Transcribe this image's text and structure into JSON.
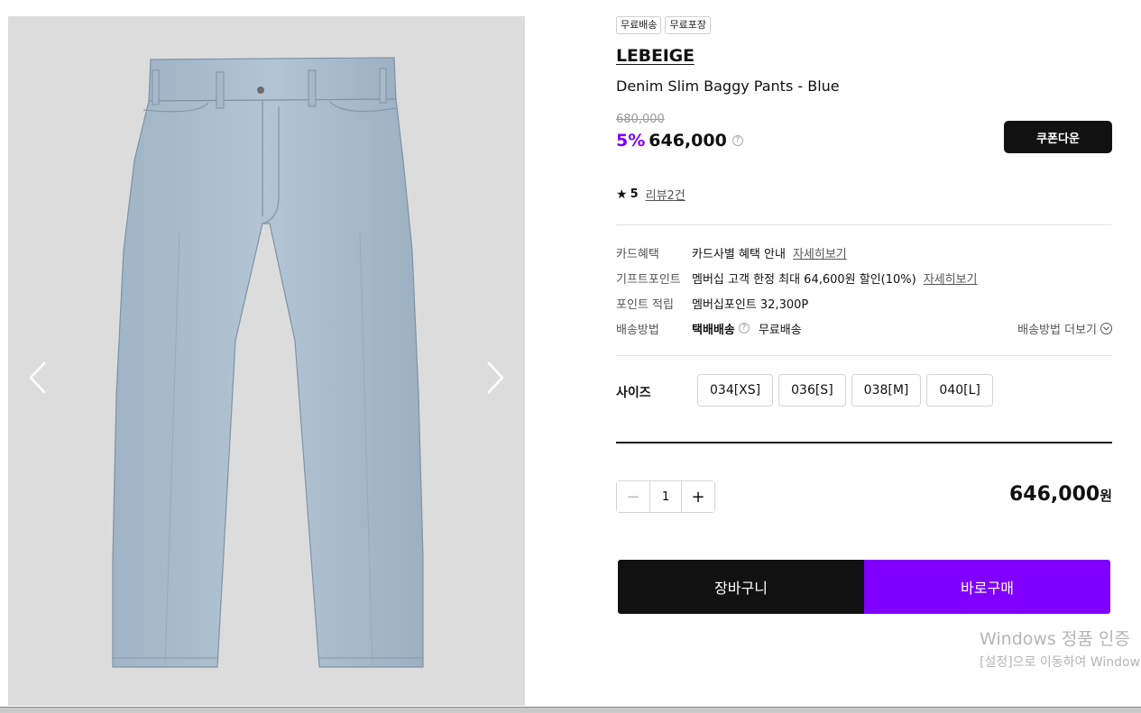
{
  "gallery": {
    "image_alt": "Denim Slim Baggy Pants - Blue",
    "prev_icon": "chevron-left-icon",
    "next_icon": "chevron-right-icon",
    "background_color": "#dcdcdc",
    "denim_color": "#a9bccd"
  },
  "badges": [
    "무료배송",
    "무료포장"
  ],
  "product": {
    "brand": "LEBEIGE",
    "name": "Denim Slim Baggy Pants - Blue",
    "original_price": "680,000",
    "discount": "5%",
    "sale_price": "646,000",
    "help_icon": "?"
  },
  "coupon": {
    "label": "쿠폰다운"
  },
  "rating": {
    "star": "★",
    "score": "5",
    "reviews": "리뷰2건"
  },
  "benefits": {
    "card": {
      "label": "카드혜택",
      "value": "카드사별 혜택 안내",
      "link": "자세히보기"
    },
    "gift_point": {
      "label": "기프트포인트",
      "value": "멤버십 고객 한정 최대 64,600원 할인(10%)",
      "link": "자세히보기"
    },
    "point": {
      "label": "포인트 적립",
      "value": "멤버십포인트 32,300P"
    },
    "shipping": {
      "label": "배송방법",
      "method": "택배배송",
      "fee": "무료배송",
      "more": "배송방법 더보기"
    }
  },
  "size": {
    "label": "사이즈",
    "options": [
      "034[XS]",
      "036[S]",
      "038[M]",
      "040[L]"
    ]
  },
  "quantity": {
    "minus": "−",
    "value": "1",
    "plus": "+"
  },
  "total": {
    "amount": "646,000",
    "unit": "원"
  },
  "actions": {
    "cart": "장바구니",
    "buy": "바로구매"
  },
  "colors": {
    "accent": "#7b00ff",
    "buy_button": "#8000ff",
    "dark": "#111111"
  },
  "watermark": {
    "title": "Windows 정품 인증",
    "subtitle": "[설정]으로 이동하여 Windows"
  }
}
